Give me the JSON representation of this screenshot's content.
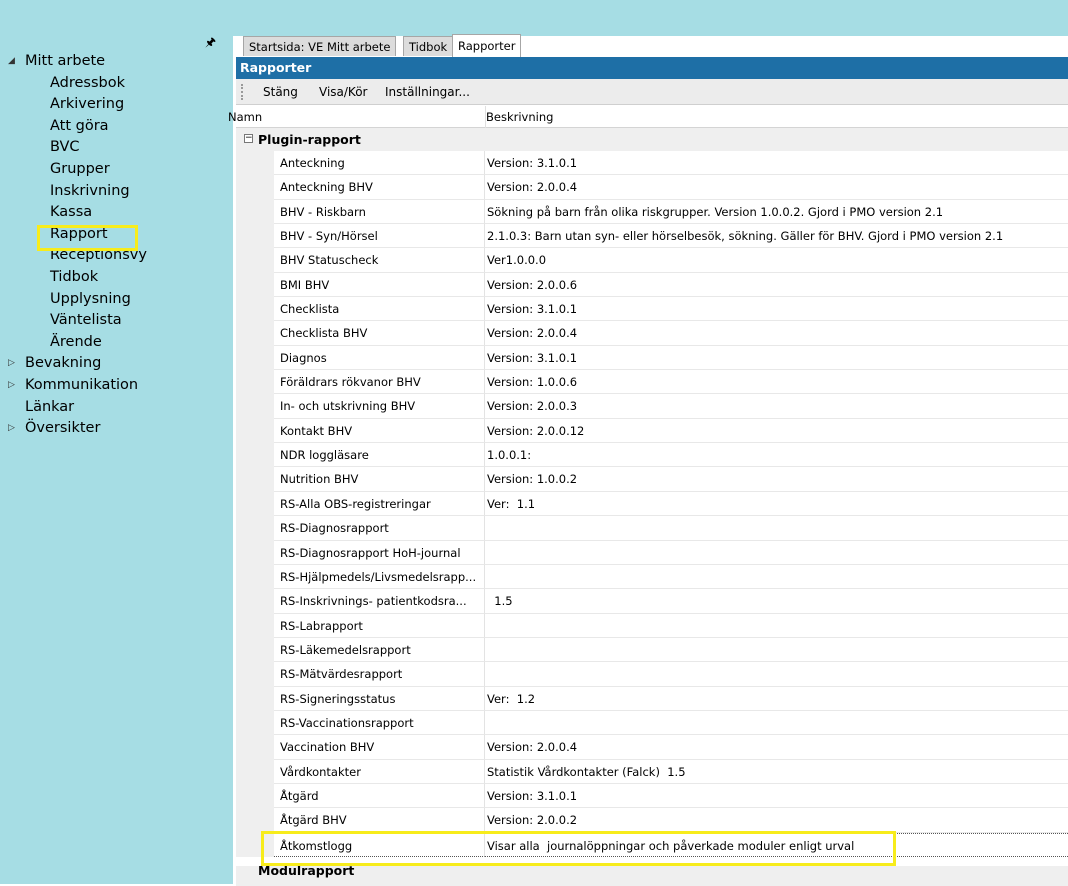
{
  "nav": {
    "pin_icon": "pin-icon",
    "items": [
      {
        "label": "Mitt arbete",
        "level": 0,
        "expander": "expanded"
      },
      {
        "label": "Adressbok",
        "level": 1
      },
      {
        "label": "Arkivering",
        "level": 1
      },
      {
        "label": "Att göra",
        "level": 1
      },
      {
        "label": "BVC",
        "level": 1
      },
      {
        "label": "Grupper",
        "level": 1
      },
      {
        "label": "Inskrivning",
        "level": 1
      },
      {
        "label": "Kassa",
        "level": 1
      },
      {
        "label": "Rapport",
        "level": 1,
        "highlighted": true
      },
      {
        "label": "Receptionsvy",
        "level": 1
      },
      {
        "label": "Tidbok",
        "level": 1
      },
      {
        "label": "Upplysning",
        "level": 1
      },
      {
        "label": "Väntelista",
        "level": 1
      },
      {
        "label": "Ärende",
        "level": 1
      },
      {
        "label": "Bevakning",
        "level": 0,
        "expander": "collapsed"
      },
      {
        "label": "Kommunikation",
        "level": 0,
        "expander": "collapsed"
      },
      {
        "label": "Länkar",
        "level": 0
      },
      {
        "label": "Översikter",
        "level": 0,
        "expander": "collapsed"
      }
    ]
  },
  "tabs": [
    {
      "label": "Startsida: VE Mitt arbete",
      "active": false
    },
    {
      "label": "Tidbok",
      "active": false
    },
    {
      "label": "Rapporter",
      "active": true
    }
  ],
  "panel": {
    "title": "Rapporter",
    "toolbar": {
      "close": "Stäng",
      "view_run": "Visa/Kör",
      "settings": "Inställningar..."
    }
  },
  "grid": {
    "columns": {
      "name": "Namn",
      "description": "Beskrivning"
    },
    "group": "Plugin-rapport",
    "next_group": "Modulrapport",
    "rows": [
      {
        "name": "Anteckning",
        "desc": "Version: 3.1.0.1"
      },
      {
        "name": "Anteckning BHV",
        "desc": "Version: 2.0.0.4"
      },
      {
        "name": "BHV - Riskbarn",
        "desc": "Sökning på barn från olika riskgrupper. Version 1.0.0.2. Gjord i PMO version 2.1"
      },
      {
        "name": "BHV - Syn/Hörsel",
        "desc": "2.1.0.3: Barn utan syn- eller hörselbesök, sökning. Gäller för BHV. Gjord i PMO version 2.1"
      },
      {
        "name": "BHV Statuscheck",
        "desc": "Ver1.0.0.0"
      },
      {
        "name": "BMI BHV",
        "desc": "Version: 2.0.0.6"
      },
      {
        "name": "Checklista",
        "desc": "Version: 3.1.0.1"
      },
      {
        "name": "Checklista BHV",
        "desc": "Version: 2.0.0.4"
      },
      {
        "name": "Diagnos",
        "desc": "Version: 3.1.0.1"
      },
      {
        "name": "Föräldrars rökvanor BHV",
        "desc": "Version: 1.0.0.6"
      },
      {
        "name": "In- och utskrivning BHV",
        "desc": "Version: 2.0.0.3"
      },
      {
        "name": "Kontakt BHV",
        "desc": "Version: 2.0.0.12"
      },
      {
        "name": "NDR loggläsare",
        "desc": "1.0.0.1:"
      },
      {
        "name": "Nutrition BHV",
        "desc": "Version: 1.0.0.2"
      },
      {
        "name": "RS-Alla OBS-registreringar",
        "desc": "Ver:  1.1"
      },
      {
        "name": "RS-Diagnosrapport",
        "desc": ""
      },
      {
        "name": "RS-Diagnosrapport HoH-journal",
        "desc": ""
      },
      {
        "name": "RS-Hjälpmedels/Livsmedelsrapp...",
        "desc": ""
      },
      {
        "name": "RS-Inskrivnings- patientkodsra...",
        "desc": "  1.5"
      },
      {
        "name": "RS-Labrapport",
        "desc": ""
      },
      {
        "name": "RS-Läkemedelsrapport",
        "desc": ""
      },
      {
        "name": "RS-Mätvärdesrapport",
        "desc": ""
      },
      {
        "name": "RS-Signeringsstatus",
        "desc": "Ver:  1.2"
      },
      {
        "name": "RS-Vaccinationsrapport",
        "desc": ""
      },
      {
        "name": "Vaccination BHV",
        "desc": "Version: 2.0.0.4"
      },
      {
        "name": "Vårdkontakter",
        "desc": "Statistik Vårdkontakter (Falck)  1.5"
      },
      {
        "name": "Åtgärd",
        "desc": "Version: 3.1.0.1"
      },
      {
        "name": "Åtgärd BHV",
        "desc": "Version: 2.0.0.2"
      },
      {
        "name": "Åtkomstlogg",
        "desc": "Visar alla  journalöppningar och påverkade moduler enligt urval",
        "selected": true
      }
    ]
  },
  "colors": {
    "nav_bg": "#a6dde4",
    "header_blue": "#1e6fa6",
    "highlight": "#f7ec1b"
  }
}
